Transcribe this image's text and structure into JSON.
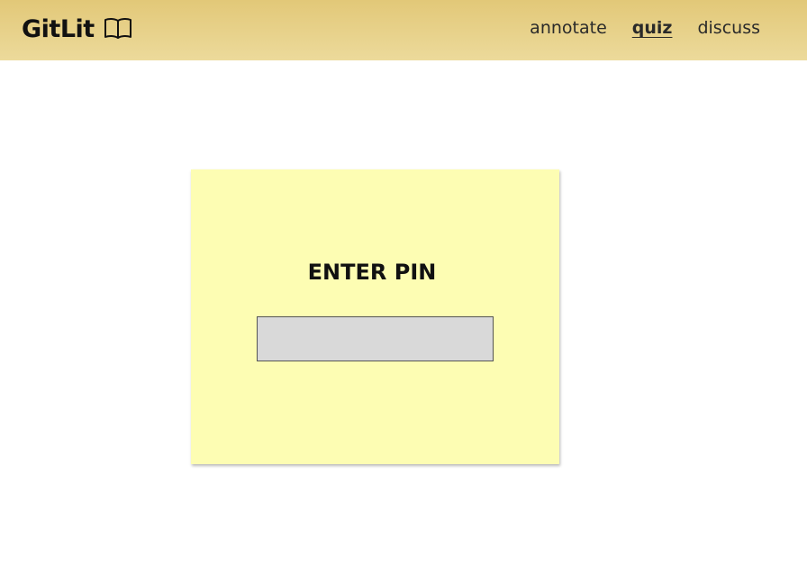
{
  "header": {
    "brand": "GitLit",
    "brand_icon": "book-icon",
    "nav": [
      {
        "label": "annotate",
        "active": false
      },
      {
        "label": "quiz",
        "active": true
      },
      {
        "label": "discuss",
        "active": false
      }
    ]
  },
  "pin_card": {
    "title": "ENTER PIN",
    "input_value": "",
    "input_placeholder": ""
  },
  "colors": {
    "header_top": "#e2c878",
    "header_bottom": "#ecda9b",
    "card_background": "#fdfdb3",
    "input_background": "#d9d9d9"
  }
}
